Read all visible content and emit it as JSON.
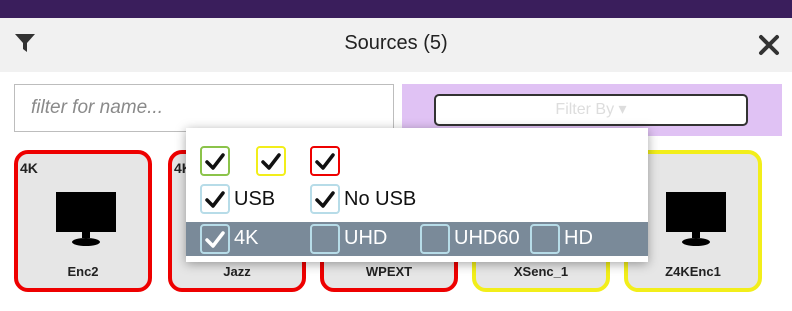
{
  "header": {
    "title": "Sources (5)",
    "filter_icon": "filter-funnel-icon",
    "close_icon": "close-x-icon"
  },
  "search": {
    "placeholder": "filter for name..."
  },
  "filter_by": {
    "label": "Filter By ▾"
  },
  "colors": {
    "topbar": "#3a1e5c",
    "filter_bg": "#e0c2f4",
    "border_red": "#ee0000",
    "border_yellow": "#f2ee1a",
    "border_green": "#8bc34a",
    "selected_row": "#7a8a99"
  },
  "dropdown": {
    "colors_row": [
      {
        "color": "green",
        "checked": true
      },
      {
        "color": "yellow",
        "checked": true
      },
      {
        "color": "red",
        "checked": true
      }
    ],
    "usb_options": [
      {
        "label": "USB",
        "checked": true
      },
      {
        "label": "No USB",
        "checked": true
      }
    ],
    "resolution_options": [
      {
        "label": "4K",
        "checked": true
      },
      {
        "label": "UHD",
        "checked": false
      },
      {
        "label": "UHD60",
        "checked": false
      },
      {
        "label": "HD",
        "checked": false
      }
    ]
  },
  "sources": [
    {
      "badge": "4K",
      "name": "Enc2",
      "border": "red",
      "icon": "monitor-icon"
    },
    {
      "badge": "4K",
      "name": "Jazz",
      "border": "red",
      "icon": "monitor-icon"
    },
    {
      "badge": "",
      "name": "WPEXT",
      "border": "red",
      "icon": "monitor-icon"
    },
    {
      "badge": "",
      "name": "XSenc_1",
      "border": "yellow",
      "icon": "monitor-icon"
    },
    {
      "badge": "",
      "name": "Z4KEnc1",
      "border": "yellow",
      "icon": "monitor-icon"
    }
  ]
}
